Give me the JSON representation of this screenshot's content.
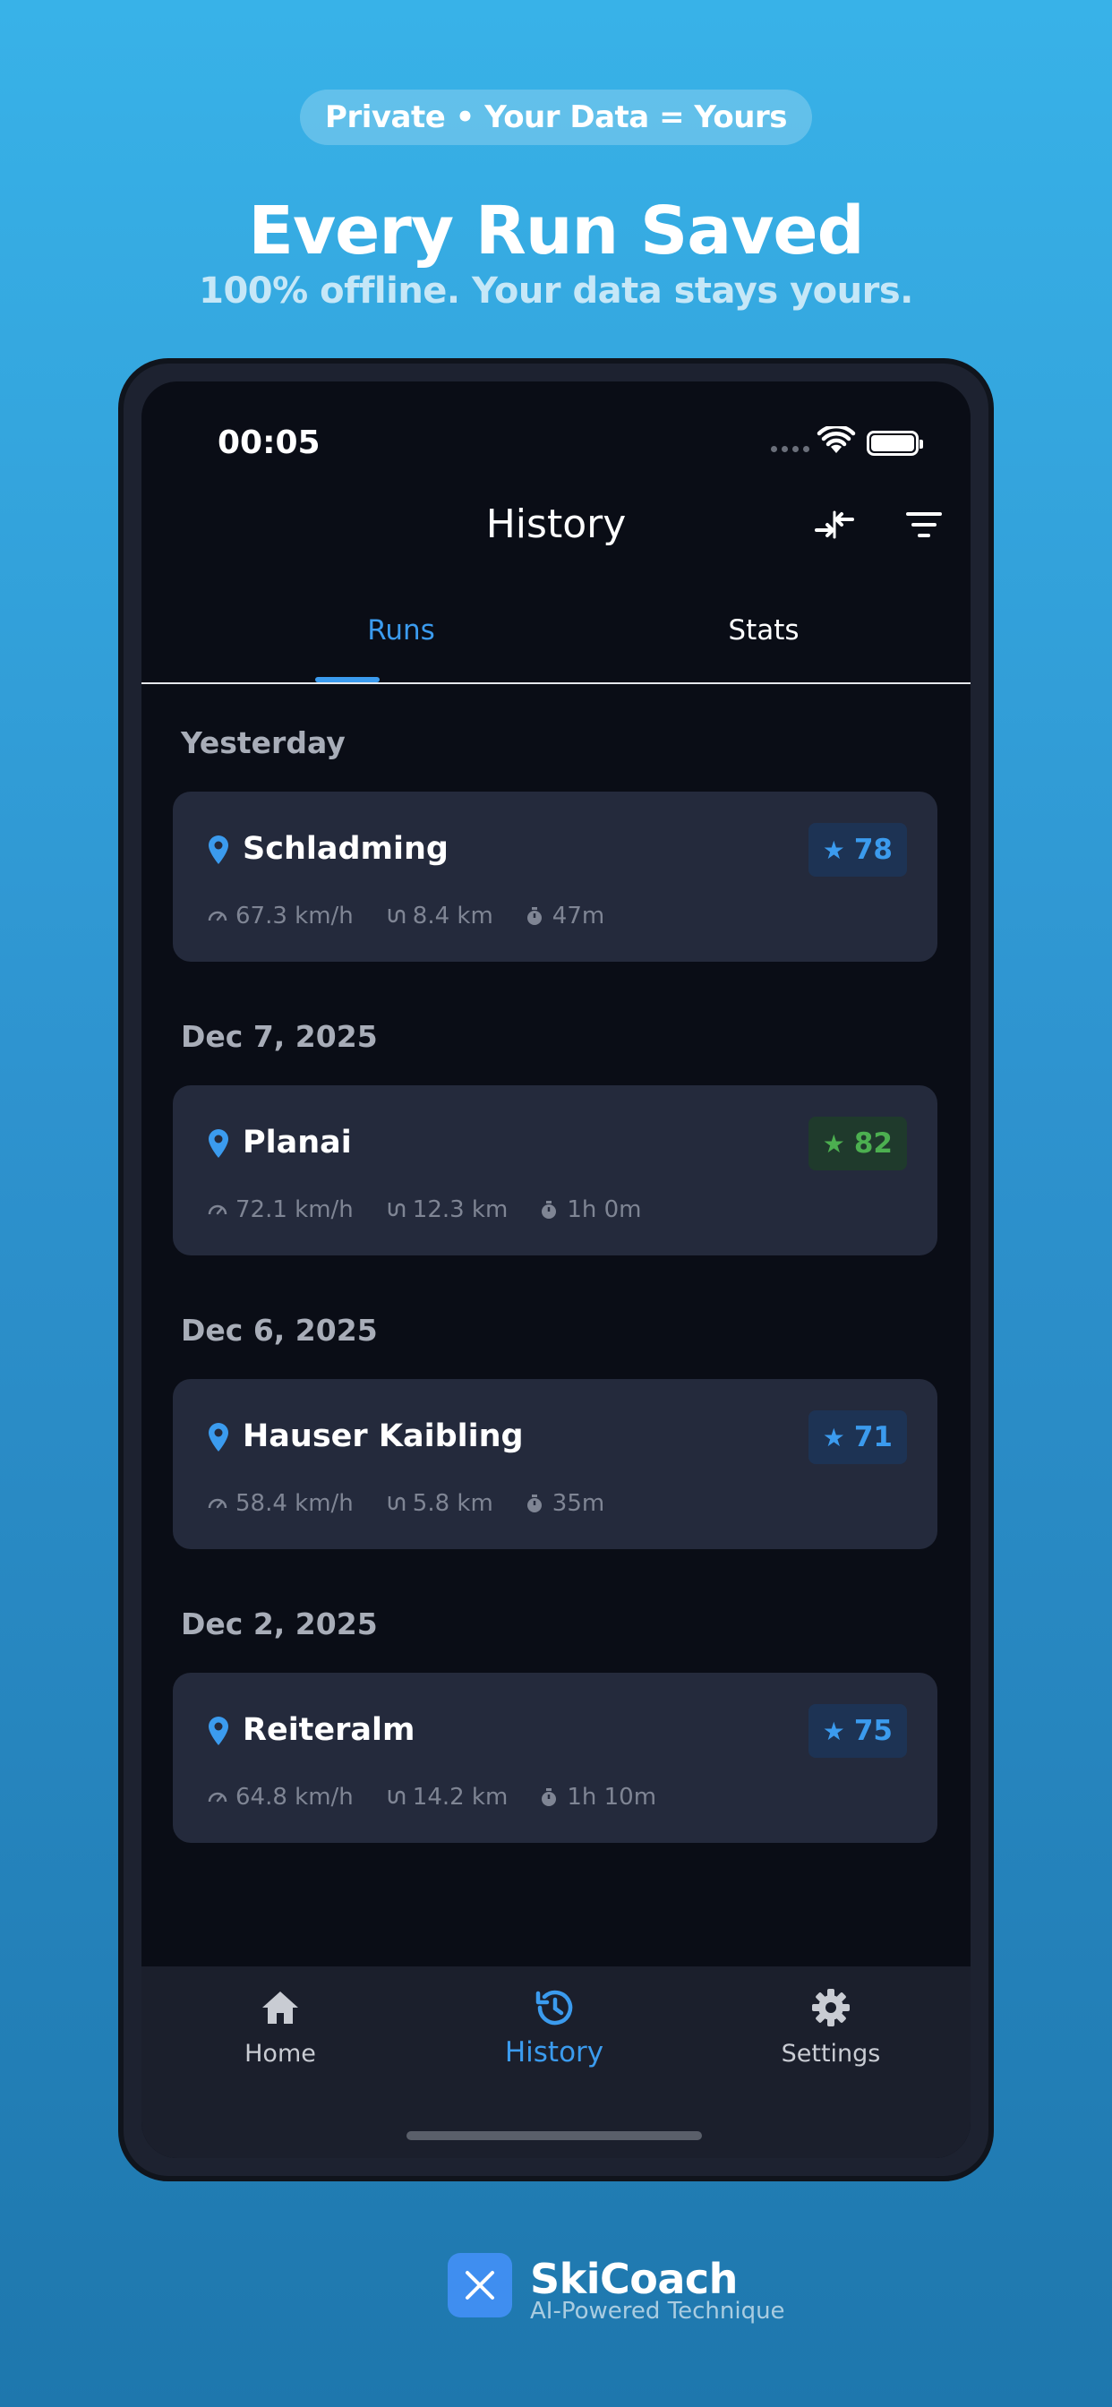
{
  "promo": {
    "pill_text": "Private  •  Your Data = Yours",
    "headline": "Every Run Saved",
    "subhead": "100% offline. Your data stays yours."
  },
  "status_bar": {
    "time": "00:05"
  },
  "header": {
    "title": "History"
  },
  "tabs": [
    {
      "label": "Runs",
      "active": true
    },
    {
      "label": "Stats",
      "active": false
    }
  ],
  "runs": [
    {
      "section": "Yesterday",
      "location": "Schladming",
      "score": "78",
      "score_color": "#3b9bee",
      "score_bg": "#1d3354",
      "speed": "67.3 km/h",
      "distance": "8.4 km",
      "duration": "47m"
    },
    {
      "section": "Dec 7, 2025",
      "location": "Planai",
      "score": "82",
      "score_color": "#4caf50",
      "score_bg": "#1f3a2c",
      "speed": "72.1 km/h",
      "distance": "12.3 km",
      "duration": "1h 0m"
    },
    {
      "section": "Dec 6, 2025",
      "location": "Hauser Kaibling",
      "score": "71",
      "score_color": "#3b9bee",
      "score_bg": "#1d3354",
      "speed": "58.4 km/h",
      "distance": "5.8 km",
      "duration": "35m"
    },
    {
      "section": "Dec 2, 2025",
      "location": "Reiteralm",
      "score": "75",
      "score_color": "#3b9bee",
      "score_bg": "#1d3354",
      "speed": "64.8 km/h",
      "distance": "14.2 km",
      "duration": "1h 10m"
    }
  ],
  "bottom_nav": [
    {
      "label": "Home",
      "icon": "home-icon"
    },
    {
      "label": "History",
      "icon": "history-icon",
      "active": true
    },
    {
      "label": "Settings",
      "icon": "gear-icon"
    }
  ],
  "brand": {
    "name": "SkiCoach",
    "tagline": "AI-Powered Technique"
  },
  "colors": {
    "accent": "#3b9bee",
    "card_bg": "#242a3c",
    "screen_bg": "#0a0d16"
  }
}
